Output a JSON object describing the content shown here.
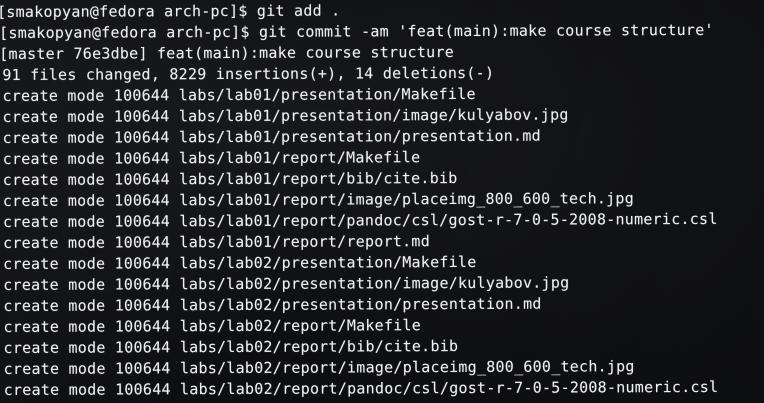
{
  "terminal": {
    "lines": [
      "[smakopyan@fedora arch-pc]$ git add .",
      "[smakopyan@fedora arch-pc]$ git commit -am 'feat(main):make course structure'",
      "[master 76e3dbe] feat(main):make course structure",
      "91 files changed, 8229 insertions(+), 14 deletions(-)",
      "create mode 100644 labs/lab01/presentation/Makefile",
      "create mode 100644 labs/lab01/presentation/image/kulyabov.jpg",
      "create mode 100644 labs/lab01/presentation/presentation.md",
      "create mode 100644 labs/lab01/report/Makefile",
      "create mode 100644 labs/lab01/report/bib/cite.bib",
      "create mode 100644 labs/lab01/report/image/placeimg_800_600_tech.jpg",
      "create mode 100644 labs/lab01/report/pandoc/csl/gost-r-7-0-5-2008-numeric.csl",
      "create mode 100644 labs/lab01/report/report.md",
      "create mode 100644 labs/lab02/presentation/Makefile",
      "create mode 100644 labs/lab02/presentation/image/kulyabov.jpg",
      "create mode 100644 labs/lab02/presentation/presentation.md",
      "create mode 100644 labs/lab02/report/Makefile",
      "create mode 100644 labs/lab02/report/bib/cite.bib",
      "create mode 100644 labs/lab02/report/image/placeimg_800_600_tech.jpg",
      "create mode 100644 labs/lab02/report/pandoc/csl/gost-r-7-0-5-2008-numeric.csl"
    ]
  },
  "colors": {
    "background": "#0e0f12",
    "text": "#eef0f2"
  }
}
